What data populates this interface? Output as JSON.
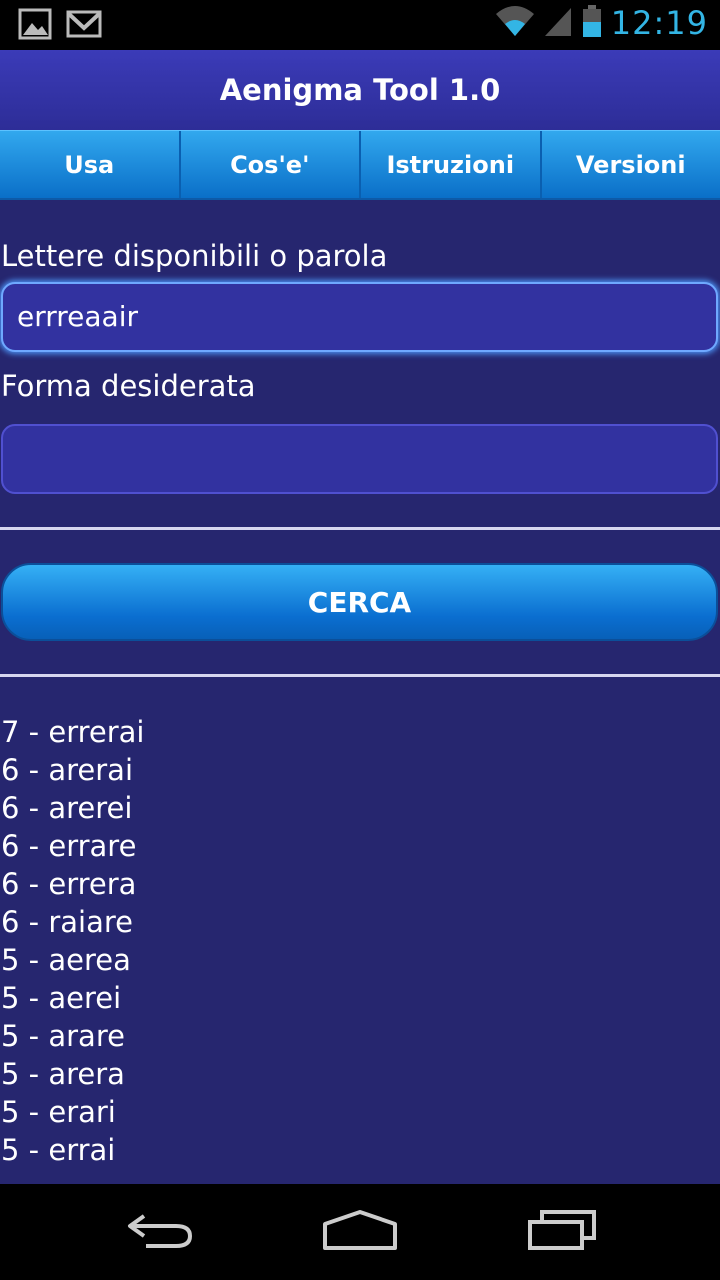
{
  "status_bar": {
    "time": "12:19",
    "icons": [
      "image-icon",
      "gmail-icon",
      "wifi-icon",
      "signal-icon",
      "battery-icon"
    ]
  },
  "app": {
    "title": "Aenigma Tool 1.0",
    "tabs": [
      {
        "label": "Usa"
      },
      {
        "label": "Cos'e'"
      },
      {
        "label": "Istruzioni"
      },
      {
        "label": "Versioni"
      }
    ]
  },
  "form": {
    "letters_label": "Lettere disponibili o parola",
    "letters_value": "errreaair",
    "shape_label": "Forma desiderata",
    "shape_value": "",
    "search_button": "CERCA"
  },
  "results": [
    "7 - errerai",
    "6 - arerai",
    "6 - arerei",
    "6 - errare",
    "6 - errera",
    "6 - raiare",
    "5 - aerea",
    "5 - aerei",
    "5 - arare",
    "5 - arera",
    "5 - erari",
    "5 - errai"
  ],
  "colors": {
    "background": "#26266f",
    "accent": "#33b5e5",
    "tab_blue": "#0a6fc8"
  },
  "nav_bar": {
    "icons": [
      "back-icon",
      "home-icon",
      "recents-icon"
    ]
  }
}
